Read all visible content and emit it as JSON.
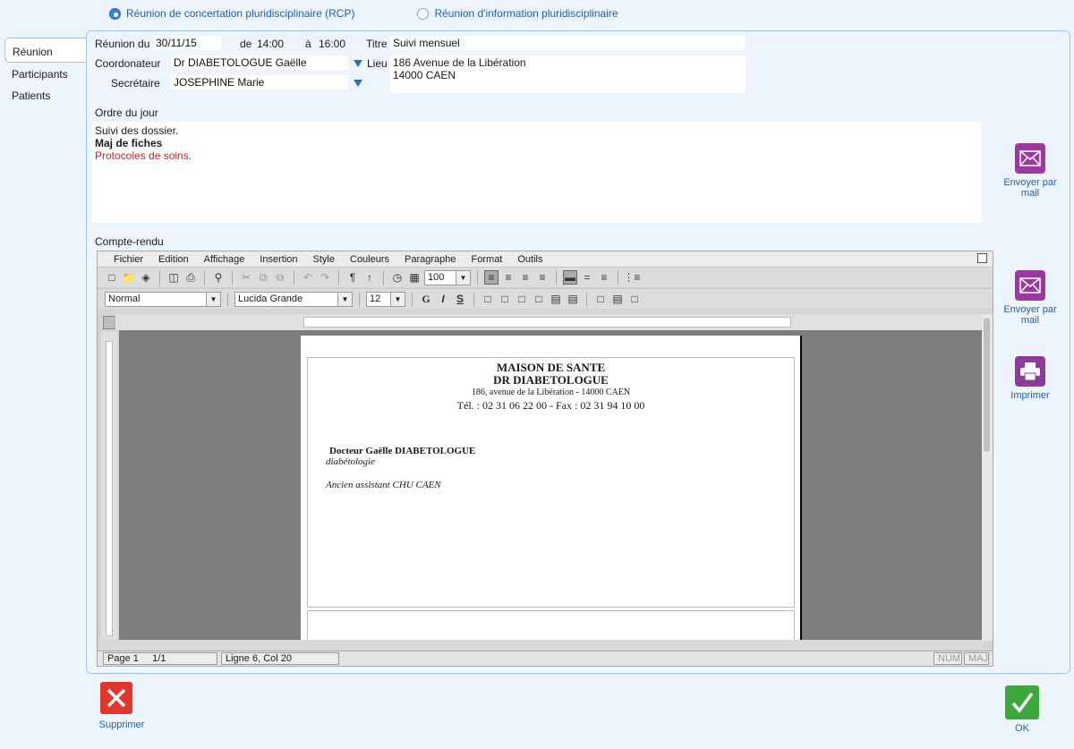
{
  "meeting_type": {
    "options": [
      {
        "label": "Réunion de concertation pluridisciplinaire (RCP)",
        "selected": true
      },
      {
        "label": "Réunion d'information pluridisciplinaire",
        "selected": false
      }
    ]
  },
  "tabs": [
    {
      "label": "Réunion",
      "active": true
    },
    {
      "label": "Participants",
      "active": false
    },
    {
      "label": "Patients",
      "active": false
    }
  ],
  "form": {
    "date_label": "Réunion du",
    "date_value": "30/11/15",
    "from_label": "de",
    "from_value": "14:00",
    "to_label": "à",
    "to_value": "16:00",
    "title_label": "Titre",
    "title_value": "Suivi mensuel",
    "coordinator_label": "Coordonateur",
    "coordinator_value": "Dr DIABETOLOGUE Gaëlle",
    "place_label": "Lieu",
    "place_line1": "186 Avenue de la Libération",
    "place_line2": "14000 CAEN",
    "secretary_label": "Secrétaire",
    "secretary_value": "JOSEPHINE Marie"
  },
  "agenda": {
    "label": "Ordre du jour",
    "line1": "Suivi des dossier.",
    "line2": "Maj de fiches",
    "line3": "Protocoles de soins."
  },
  "report": {
    "label": "Compte-rendu",
    "menu": [
      "Fichier",
      "Edition",
      "Affichage",
      "Insertion",
      "Style",
      "Couleurs",
      "Paragraphe",
      "Format",
      "Outils"
    ],
    "zoom": "100",
    "style": "Normal",
    "font": "Lucida Grande",
    "size": "12",
    "bold_btn": "G",
    "italic_btn": "I",
    "underline_btn": "S",
    "document": {
      "org": "MAISON DE SANTE",
      "doctor_header": "DR DIABETOLOGUE",
      "address": "186, avenue de la Libération - 14000 CAEN",
      "phone": "Tél. : 02 31 06 22 00 - Fax : 02 31 94 10 00",
      "doctor_name": "Docteur Gaëlle DIABETOLOGUE",
      "specialty": "diabétologie",
      "former": "Ancien assistant CHU CAEN"
    },
    "status": {
      "page": "Page 1",
      "pages": "1/1",
      "cursor": "Ligne 6, Col 20",
      "num": "NUM",
      "caps": "MAJ"
    }
  },
  "actions": {
    "mail1": "Envoyer par mail",
    "mail2": "Envoyer par mail",
    "print": "Imprimer",
    "delete": "Supprimer",
    "ok": "OK"
  },
  "colors": {
    "accent": "#1f5fa8",
    "mail_icon": "#9a3aa0",
    "delete_icon": "#e2372c",
    "ok_icon": "#3fa83c",
    "agenda_highlight": "#cc2222"
  }
}
